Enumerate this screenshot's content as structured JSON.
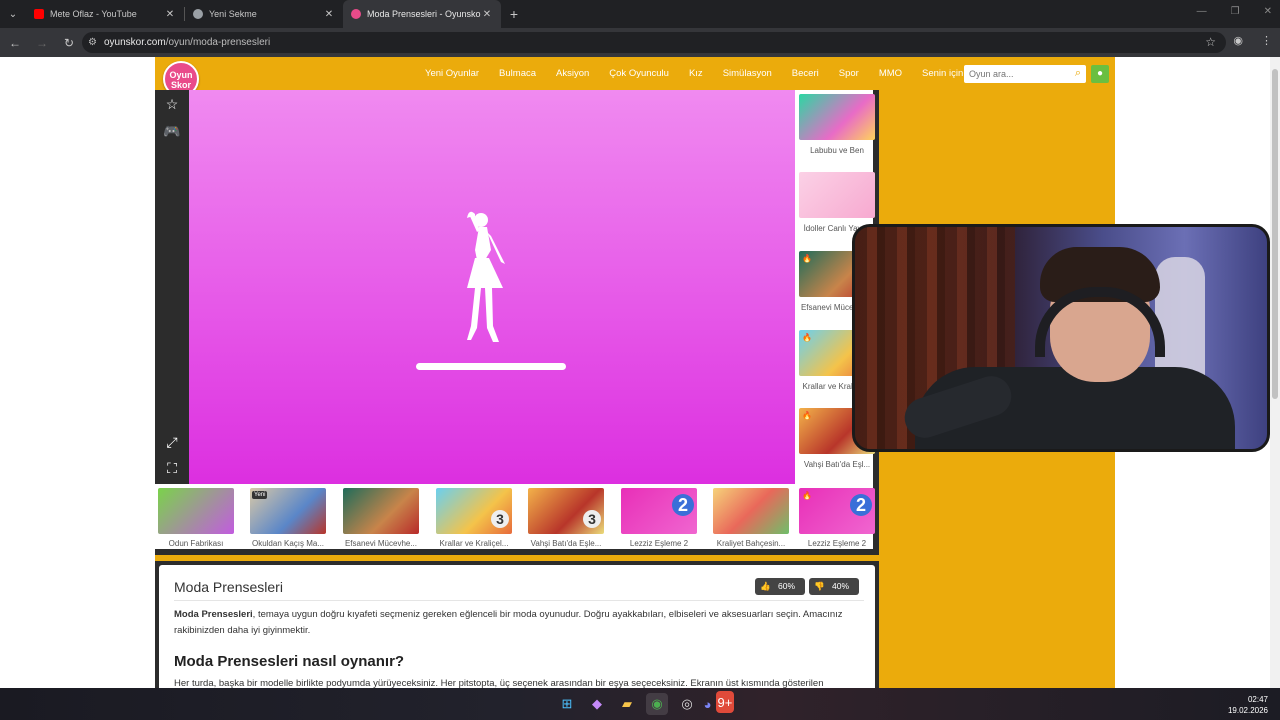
{
  "browser": {
    "tabs": [
      {
        "title": "Mete Oflaz - YouTube",
        "favicon_color": "#ff0000",
        "active": false
      },
      {
        "title": "Yeni Sekme",
        "favicon_color": "#9aa0a6",
        "active": false
      },
      {
        "title": "Moda Prensesleri - Oyunskor.com",
        "favicon_color": "#e94b8a",
        "active": true
      }
    ],
    "url_host": "oyunskor.com",
    "url_path": "/oyun/moda-prensesleri"
  },
  "site": {
    "logo_line1": "Oyun",
    "logo_line2": "Skor",
    "menu": [
      "Yeni Oyunlar",
      "Bulmaca",
      "Aksiyon",
      "Çok Oyunculu",
      "Kız",
      "Simülasyon",
      "Beceri",
      "Spor",
      "MMO",
      "Senin için"
    ],
    "search_placeholder": "Oyun ara...",
    "accent_color": "#ebab0c"
  },
  "side_games": [
    {
      "label": "Labubu ve Ben",
      "hot": false
    },
    {
      "label": "İdoller Canlı Yayı...",
      "hot": false
    },
    {
      "label": "Efsanevi Mücevhe...",
      "hot": true
    },
    {
      "label": "Krallar ve Kraliçel...",
      "hot": true
    },
    {
      "label": "Vahşi Batı'da Eşl...",
      "hot": true
    }
  ],
  "bottom_games": [
    {
      "label": "Odun Fabrikası",
      "badge": ""
    },
    {
      "label": "Okuldan Kaçış Ma...",
      "badge": "Yeni"
    },
    {
      "label": "Efsanevi Mücevhe...",
      "badge": ""
    },
    {
      "label": "Krallar ve Kraliçel...",
      "badge": "3"
    },
    {
      "label": "Vahşi Batı'da Eşle...",
      "badge": "3"
    },
    {
      "label": "Lezziz Eşleme 2",
      "badge": "2"
    },
    {
      "label": "Kraliyet Bahçesin...",
      "badge": ""
    },
    {
      "label": "Lezziz Eşleme 2",
      "badge": "2"
    }
  ],
  "info": {
    "title": "Moda Prensesleri",
    "likes": "60%",
    "dislikes": "40%",
    "desc_bold": "Moda Prensesleri",
    "desc_rest": ", temaya uygun doğru kıyafeti seçmeniz gereken eğlenceli bir moda oyunudur. Doğru ayakkabıları, elbiseleri ve aksesuarları seçin. Amacınız rakibinizden daha iyi giyinmektir.",
    "how_title": "Moda Prensesleri nasıl oynanır?",
    "how_text": "Her turda, başka bir modelle birlikte podyumda yürüyeceksiniz. Her pitstopta, üç seçenek arasından bir eşya seçeceksiniz. Ekranın üst kısmında gösterilen"
  },
  "taskbar": {
    "time": "02:47",
    "date": "19.02.2026",
    "discord_badge": "9+"
  }
}
